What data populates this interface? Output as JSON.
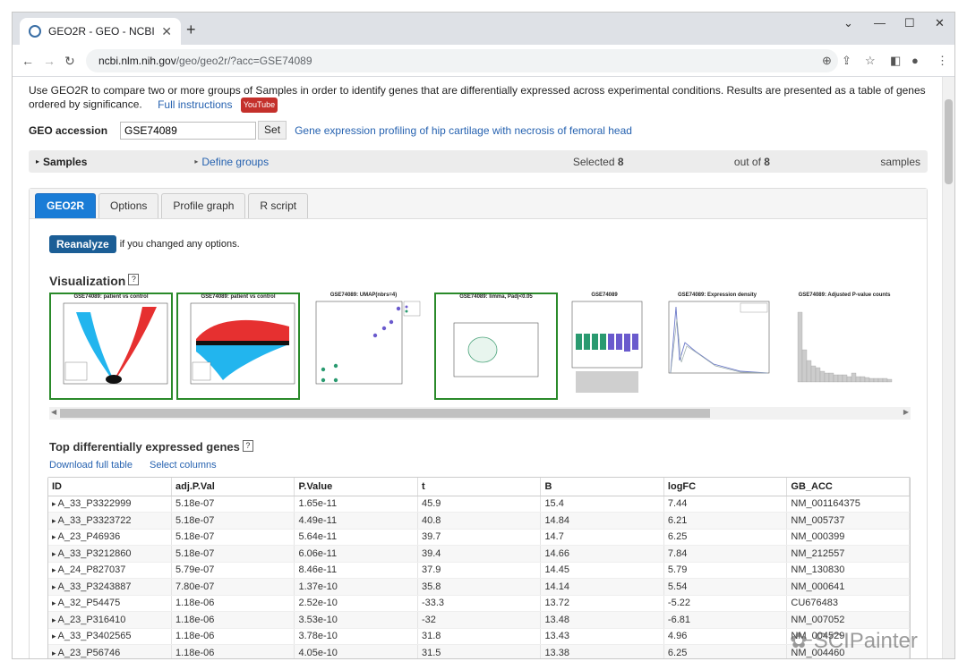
{
  "browser": {
    "tab_title": "GEO2R - GEO - NCBI",
    "url_host": "ncbi.nlm.nih.gov",
    "url_path": "/geo/geo2r/?acc=GSE74089"
  },
  "intro": {
    "text": "Use GEO2R to compare two or more groups of Samples in order to identify genes that are differentially expressed across experimental conditions. Results are presented as a table of genes ordered by significance.",
    "instructions_link": "Full instructions",
    "youtube": "YouTube"
  },
  "accession": {
    "label": "GEO accession",
    "value": "GSE74089",
    "set_label": "Set",
    "description": "Gene expression profiling of hip cartilage with necrosis of femoral head"
  },
  "samples": {
    "label": "Samples",
    "define_groups": "Define groups",
    "selected_prefix": "Selected",
    "selected_count": "8",
    "out_of": "out of",
    "total": "8",
    "suffix": "samples"
  },
  "tabs": [
    "GEO2R",
    "Options",
    "Profile graph",
    "R script"
  ],
  "reanalyze": {
    "button": "Reanalyze",
    "note": "if you changed any options."
  },
  "visualization": {
    "title": "Visualization",
    "help": "?",
    "plots": [
      {
        "title": "GSE74089: patient vs control"
      },
      {
        "title": "GSE74089: patient vs control"
      },
      {
        "title": "GSE74089: UMAP(nbrs=4)"
      },
      {
        "title": "GSE74089: limma, Padj<0.05"
      },
      {
        "title": "GSE74089"
      },
      {
        "title": "GSE74089: Expression density"
      },
      {
        "title": "GSE74089: Adjusted P-value counts"
      }
    ]
  },
  "results": {
    "title": "Top differentially expressed genes",
    "help": "?",
    "download": "Download full table",
    "select_columns": "Select columns",
    "columns": [
      "ID",
      "adj.P.Val",
      "P.Value",
      "t",
      "B",
      "logFC",
      "GB_ACC"
    ],
    "rows": [
      [
        "A_33_P3322999",
        "5.18e-07",
        "1.65e-11",
        "45.9",
        "15.4",
        "7.44",
        "NM_001164375"
      ],
      [
        "A_33_P3323722",
        "5.18e-07",
        "4.49e-11",
        "40.8",
        "14.84",
        "6.21",
        "NM_005737"
      ],
      [
        "A_23_P46936",
        "5.18e-07",
        "5.64e-11",
        "39.7",
        "14.7",
        "6.25",
        "NM_000399"
      ],
      [
        "A_33_P3212860",
        "5.18e-07",
        "6.06e-11",
        "39.4",
        "14.66",
        "7.84",
        "NM_212557"
      ],
      [
        "A_24_P827037",
        "5.79e-07",
        "8.46e-11",
        "37.9",
        "14.45",
        "5.79",
        "NM_130830"
      ],
      [
        "A_33_P3243887",
        "7.80e-07",
        "1.37e-10",
        "35.8",
        "14.14",
        "5.54",
        "NM_000641"
      ],
      [
        "A_32_P54475",
        "1.18e-06",
        "2.52e-10",
        "-33.3",
        "13.72",
        "-5.22",
        "CU676483"
      ],
      [
        "A_23_P316410",
        "1.18e-06",
        "3.53e-10",
        "-32",
        "13.48",
        "-6.81",
        "NM_007052"
      ],
      [
        "A_33_P3402565",
        "1.18e-06",
        "3.78e-10",
        "31.8",
        "13.43",
        "4.96",
        "NM_004529"
      ],
      [
        "A_23_P56746",
        "1.18e-06",
        "4.05e-10",
        "31.5",
        "13.38",
        "6.25",
        "NM_004460"
      ]
    ]
  },
  "watermark": "SCIPainter"
}
